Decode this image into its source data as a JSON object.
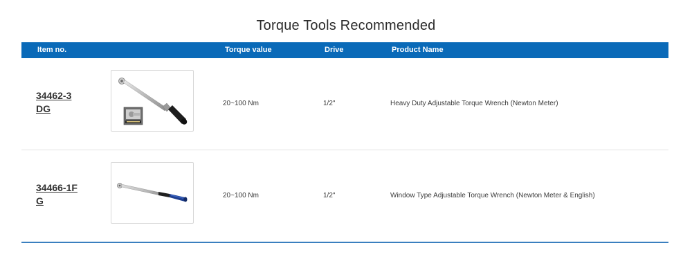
{
  "page": {
    "title": "Torque Tools Recommended"
  },
  "table": {
    "headers": {
      "item": "Item no.",
      "image": "",
      "torque": "Torque value",
      "drive": "Drive",
      "name": "Product Name"
    },
    "rows": [
      {
        "item_no": "34462-3DG",
        "image_icon": "torque-wrench-black-grip-photo",
        "torque": "20~100 Nm",
        "drive": "1/2\"",
        "name": "Heavy Duty Adjustable Torque Wrench (Newton Meter)"
      },
      {
        "item_no": "34466-1FG",
        "image_icon": "torque-wrench-blue-grip-photo",
        "torque": "20~100 Nm",
        "drive": "1/2\"",
        "name": "Window Type Adjustable Torque Wrench (Newton Meter & English)"
      }
    ]
  },
  "colors": {
    "header_bg": "#0a6ab8",
    "header_text": "#ffffff",
    "bottom_rule": "#3a7fbf",
    "row_divider": "#e3e3e3"
  }
}
